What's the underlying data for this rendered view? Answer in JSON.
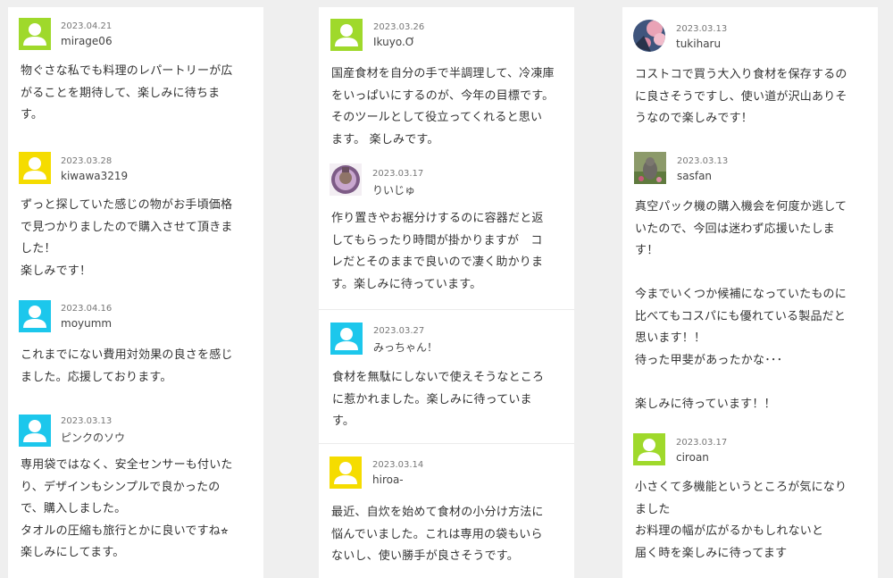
{
  "columns": [
    {
      "comments": [
        {
          "date": "2023.04.21",
          "user": "mirage06",
          "avatar": {
            "kind": "person",
            "bg": "#9fd92b"
          },
          "lines": [
            "物ぐさな私でも料理のレパートリーが広",
            "がることを期待して、楽しみに待ちま",
            "す。"
          ]
        },
        {
          "date": "2023.03.28",
          "user": "kiwawa3219",
          "avatar": {
            "kind": "person",
            "bg": "#f5dc00"
          },
          "lines": [
            "ずっと探していた感じの物がお手頃価格",
            "で見つかりましたので購入させて頂きま",
            "した！",
            "楽しみです！"
          ]
        },
        {
          "date": "2023.04.16",
          "user": "moyumm",
          "avatar": {
            "kind": "person",
            "bg": "#1cc7ec"
          },
          "lines": [
            "これまでにない費用対効果の良さを感じ",
            "ました。応援しております。"
          ]
        },
        {
          "date": "2023.03.13",
          "user": "ピンクのソウ",
          "avatar": {
            "kind": "person",
            "bg": "#1cc7ec"
          },
          "lines": [
            "専用袋ではなく、安全センサーも付いた",
            "り、デザインもシンプルで良かったの",
            "で、購入しました。",
            "タオルの圧縮も旅行とかに良いですね⭐︎",
            "楽しみにしてます。"
          ]
        }
      ]
    },
    {
      "comments": [
        {
          "date": "2023.03.26",
          "user": "Ikuyo.Ơ",
          "avatar": {
            "kind": "person",
            "bg": "#9fd92b"
          },
          "lines": [
            "国産食材を自分の手で半調理して、冷凍庫",
            "をいっぱいにするのが、今年の目標です。",
            "そのツールとして役立ってくれると思い",
            "ます。 楽しみです。"
          ]
        },
        {
          "date": "2023.03.17",
          "user": "りいじゅ",
          "avatar": {
            "kind": "photo-ring",
            "bg": "#8a6a8c"
          },
          "lines": [
            "作り置きやお裾分けするのに容器だと返",
            "してもらったり時間が掛かりますが　コ",
            "レだとそのままで良いので凄く助かりま",
            "す。楽しみに待っています。"
          ]
        },
        {
          "date": "2023.03.27",
          "user": "みっちゃん！",
          "avatar": {
            "kind": "person",
            "bg": "#1cc7ec"
          },
          "lines": [
            "食材を無駄にしないで使えそうなところ",
            "に惹かれました。楽しみに待っていま",
            "す。"
          ]
        },
        {
          "date": "2023.03.14",
          "user": "hiroa-",
          "avatar": {
            "kind": "person",
            "bg": "#f5dc00"
          },
          "lines": [
            "最近、自炊を始めて食材の小分け方法に",
            "悩んでいました。これは専用の袋もいら",
            "ないし、使い勝手が良さそうです。"
          ]
        }
      ]
    },
    {
      "comments": [
        {
          "date": "2023.03.13",
          "user": "tukiharu",
          "avatar": {
            "kind": "photo-blossom",
            "bg": "#4a5f86"
          },
          "lines": [
            "コストコで買う大入り食材を保存するの",
            "に良さそうですし、使い道が沢山ありそ",
            "うなので楽しみです！"
          ]
        },
        {
          "date": "2023.03.13",
          "user": "sasfan",
          "avatar": {
            "kind": "photo-garden",
            "bg": "#7a8a5a"
          },
          "lines": [
            "真空パック機の購入機会を何度か逃して",
            "いたので、今回は迷わず応援いたしま",
            "す！",
            "",
            "今までいくつか候補になっていたものに",
            "比べてもコスパにも優れている製品だと",
            "思います！！",
            "待った甲斐があったかな･･･",
            "",
            "楽しみに待っています！！"
          ]
        },
        {
          "date": "2023.03.17",
          "user": "ciroan",
          "avatar": {
            "kind": "person",
            "bg": "#9fd92b"
          },
          "lines": [
            "小さくて多機能というところが気になり",
            "ました",
            "お料理の幅が広がるかもしれないと",
            "届く時を楽しみに待ってます"
          ]
        }
      ]
    }
  ]
}
